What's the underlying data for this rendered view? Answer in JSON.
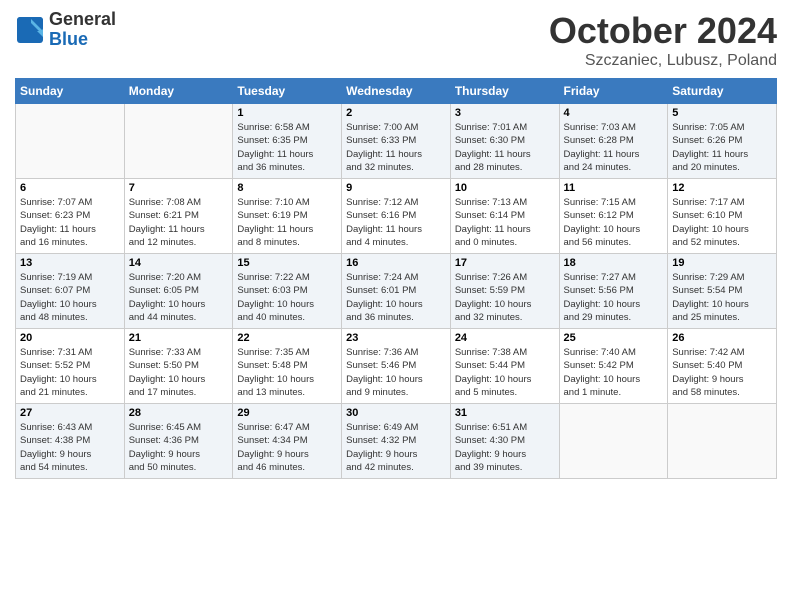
{
  "header": {
    "logo_general": "General",
    "logo_blue": "Blue",
    "month_title": "October 2024",
    "location": "Szczaniec, Lubusz, Poland"
  },
  "days_of_week": [
    "Sunday",
    "Monday",
    "Tuesday",
    "Wednesday",
    "Thursday",
    "Friday",
    "Saturday"
  ],
  "weeks": [
    [
      {
        "day": "",
        "info": ""
      },
      {
        "day": "",
        "info": ""
      },
      {
        "day": "1",
        "info": "Sunrise: 6:58 AM\nSunset: 6:35 PM\nDaylight: 11 hours\nand 36 minutes."
      },
      {
        "day": "2",
        "info": "Sunrise: 7:00 AM\nSunset: 6:33 PM\nDaylight: 11 hours\nand 32 minutes."
      },
      {
        "day": "3",
        "info": "Sunrise: 7:01 AM\nSunset: 6:30 PM\nDaylight: 11 hours\nand 28 minutes."
      },
      {
        "day": "4",
        "info": "Sunrise: 7:03 AM\nSunset: 6:28 PM\nDaylight: 11 hours\nand 24 minutes."
      },
      {
        "day": "5",
        "info": "Sunrise: 7:05 AM\nSunset: 6:26 PM\nDaylight: 11 hours\nand 20 minutes."
      }
    ],
    [
      {
        "day": "6",
        "info": "Sunrise: 7:07 AM\nSunset: 6:23 PM\nDaylight: 11 hours\nand 16 minutes."
      },
      {
        "day": "7",
        "info": "Sunrise: 7:08 AM\nSunset: 6:21 PM\nDaylight: 11 hours\nand 12 minutes."
      },
      {
        "day": "8",
        "info": "Sunrise: 7:10 AM\nSunset: 6:19 PM\nDaylight: 11 hours\nand 8 minutes."
      },
      {
        "day": "9",
        "info": "Sunrise: 7:12 AM\nSunset: 6:16 PM\nDaylight: 11 hours\nand 4 minutes."
      },
      {
        "day": "10",
        "info": "Sunrise: 7:13 AM\nSunset: 6:14 PM\nDaylight: 11 hours\nand 0 minutes."
      },
      {
        "day": "11",
        "info": "Sunrise: 7:15 AM\nSunset: 6:12 PM\nDaylight: 10 hours\nand 56 minutes."
      },
      {
        "day": "12",
        "info": "Sunrise: 7:17 AM\nSunset: 6:10 PM\nDaylight: 10 hours\nand 52 minutes."
      }
    ],
    [
      {
        "day": "13",
        "info": "Sunrise: 7:19 AM\nSunset: 6:07 PM\nDaylight: 10 hours\nand 48 minutes."
      },
      {
        "day": "14",
        "info": "Sunrise: 7:20 AM\nSunset: 6:05 PM\nDaylight: 10 hours\nand 44 minutes."
      },
      {
        "day": "15",
        "info": "Sunrise: 7:22 AM\nSunset: 6:03 PM\nDaylight: 10 hours\nand 40 minutes."
      },
      {
        "day": "16",
        "info": "Sunrise: 7:24 AM\nSunset: 6:01 PM\nDaylight: 10 hours\nand 36 minutes."
      },
      {
        "day": "17",
        "info": "Sunrise: 7:26 AM\nSunset: 5:59 PM\nDaylight: 10 hours\nand 32 minutes."
      },
      {
        "day": "18",
        "info": "Sunrise: 7:27 AM\nSunset: 5:56 PM\nDaylight: 10 hours\nand 29 minutes."
      },
      {
        "day": "19",
        "info": "Sunrise: 7:29 AM\nSunset: 5:54 PM\nDaylight: 10 hours\nand 25 minutes."
      }
    ],
    [
      {
        "day": "20",
        "info": "Sunrise: 7:31 AM\nSunset: 5:52 PM\nDaylight: 10 hours\nand 21 minutes."
      },
      {
        "day": "21",
        "info": "Sunrise: 7:33 AM\nSunset: 5:50 PM\nDaylight: 10 hours\nand 17 minutes."
      },
      {
        "day": "22",
        "info": "Sunrise: 7:35 AM\nSunset: 5:48 PM\nDaylight: 10 hours\nand 13 minutes."
      },
      {
        "day": "23",
        "info": "Sunrise: 7:36 AM\nSunset: 5:46 PM\nDaylight: 10 hours\nand 9 minutes."
      },
      {
        "day": "24",
        "info": "Sunrise: 7:38 AM\nSunset: 5:44 PM\nDaylight: 10 hours\nand 5 minutes."
      },
      {
        "day": "25",
        "info": "Sunrise: 7:40 AM\nSunset: 5:42 PM\nDaylight: 10 hours\nand 1 minute."
      },
      {
        "day": "26",
        "info": "Sunrise: 7:42 AM\nSunset: 5:40 PM\nDaylight: 9 hours\nand 58 minutes."
      }
    ],
    [
      {
        "day": "27",
        "info": "Sunrise: 6:43 AM\nSunset: 4:38 PM\nDaylight: 9 hours\nand 54 minutes."
      },
      {
        "day": "28",
        "info": "Sunrise: 6:45 AM\nSunset: 4:36 PM\nDaylight: 9 hours\nand 50 minutes."
      },
      {
        "day": "29",
        "info": "Sunrise: 6:47 AM\nSunset: 4:34 PM\nDaylight: 9 hours\nand 46 minutes."
      },
      {
        "day": "30",
        "info": "Sunrise: 6:49 AM\nSunset: 4:32 PM\nDaylight: 9 hours\nand 42 minutes."
      },
      {
        "day": "31",
        "info": "Sunrise: 6:51 AM\nSunset: 4:30 PM\nDaylight: 9 hours\nand 39 minutes."
      },
      {
        "day": "",
        "info": ""
      },
      {
        "day": "",
        "info": ""
      }
    ]
  ]
}
